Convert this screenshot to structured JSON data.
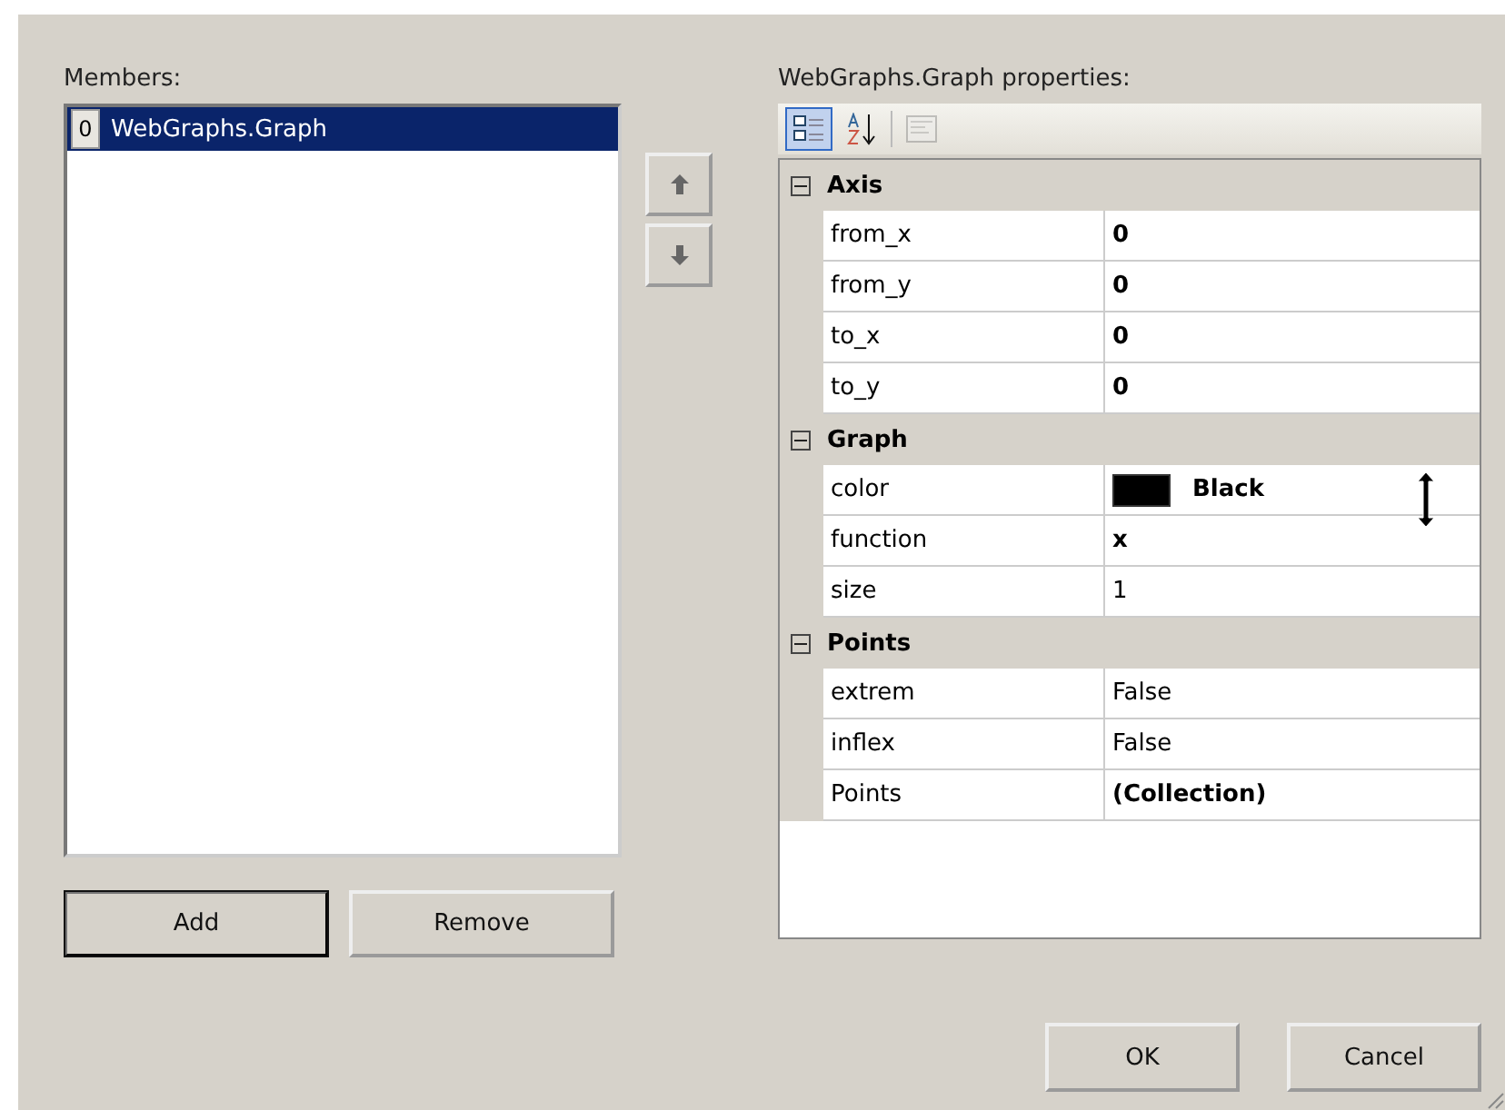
{
  "members": {
    "label": "Members:",
    "items": [
      {
        "index": "0",
        "name": "WebGraphs.Graph",
        "selected": true
      }
    ]
  },
  "move_buttons": [
    {
      "kind": "up"
    },
    {
      "kind": "down"
    }
  ],
  "list_buttons": [
    {
      "label": "Add",
      "default": true
    },
    {
      "label": "Remove",
      "default": false
    }
  ],
  "properties": {
    "label": "WebGraphs.Graph properties:",
    "toolbar": [
      {
        "kind": "categorized",
        "selected": true,
        "disabled": false
      },
      {
        "kind": "alphabetical",
        "selected": false,
        "disabled": false
      },
      {
        "kind": "pages",
        "selected": false,
        "disabled": true
      }
    ],
    "categories": [
      {
        "name": "Axis",
        "expanded": true,
        "rows": [
          {
            "name": "from_x",
            "value": "0",
            "modified": true
          },
          {
            "name": "from_y",
            "value": "0",
            "modified": true
          },
          {
            "name": "to_x",
            "value": "0",
            "modified": true
          },
          {
            "name": "to_y",
            "value": "0",
            "modified": true
          }
        ]
      },
      {
        "name": "Graph",
        "expanded": true,
        "rows": [
          {
            "name": "color",
            "value": "Black",
            "modified": true,
            "color": "#000000"
          },
          {
            "name": "function",
            "value": "x",
            "modified": true
          },
          {
            "name": "size",
            "value": "1",
            "modified": false
          }
        ]
      },
      {
        "name": "Points",
        "expanded": true,
        "rows": [
          {
            "name": "extrem",
            "value": "False",
            "modified": false
          },
          {
            "name": "inflex",
            "value": "False",
            "modified": false
          },
          {
            "name": "Points",
            "value": "(Collection)",
            "modified": true
          }
        ]
      }
    ]
  },
  "dialog_buttons": [
    {
      "label": "OK"
    },
    {
      "label": "Cancel"
    }
  ]
}
